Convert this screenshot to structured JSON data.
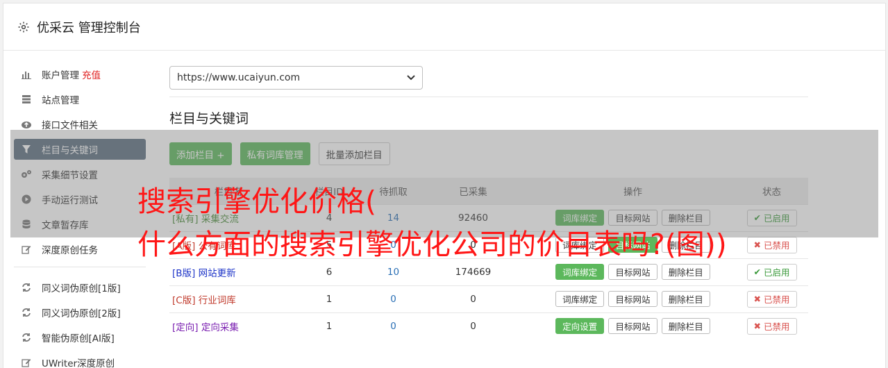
{
  "header": {
    "title": "优采云 管理控制台",
    "icon": "gear-icon"
  },
  "sidebar": {
    "items": [
      {
        "label": "账户管理",
        "badge": "充值",
        "icon": "bar-chart-icon"
      },
      {
        "label": "站点管理",
        "icon": "server-icon"
      },
      {
        "label": "接口文件相关",
        "icon": "cloud-upload-icon"
      },
      {
        "label": "栏目与关键词",
        "icon": "filter-icon",
        "active": true
      },
      {
        "label": "采集细节设置",
        "icon": "cogs-icon"
      },
      {
        "label": "手动运行测试",
        "icon": "play-circle-icon"
      },
      {
        "label": "文章暂存库",
        "icon": "database-icon"
      },
      {
        "label": "深度原创任务",
        "icon": "edit-icon"
      }
    ],
    "items2": [
      {
        "label": "同义词伪原创[1版]",
        "icon": "refresh-icon"
      },
      {
        "label": "同义词伪原创[2版]",
        "icon": "refresh-icon"
      },
      {
        "label": "智能伪原创[AI版]",
        "icon": "refresh-icon"
      },
      {
        "label": "UWriter深度原创",
        "icon": "edit-icon"
      }
    ]
  },
  "main": {
    "site_select": "https://www.ucaiyun.com",
    "section_title": "栏目与关键词",
    "buttons": {
      "add": "添加栏目 +",
      "private": "私有词库管理",
      "batch": "批量添加栏目"
    },
    "table": {
      "headers": [
        "栏目名",
        "栏目ID",
        "待抓取",
        "已采集",
        "操作",
        "状态"
      ],
      "rows": [
        {
          "tag": "[私有]",
          "name": "采集交流",
          "id": "4",
          "pending": "14",
          "collected": "92460",
          "op1": "词库绑定",
          "op2": "目标网站",
          "op3": "删除栏目",
          "status": "已启用"
        },
        {
          "tag": "[A版]",
          "name": "公有词库",
          "id": "5",
          "pending": "0",
          "collected": "0",
          "op1": "词库绑定",
          "op2": "目标网站",
          "op3": "删除栏目",
          "status": "已禁用"
        },
        {
          "tag": "[B版]",
          "name": "网站更新",
          "id": "6",
          "pending": "10",
          "collected": "174669",
          "op1": "词库绑定",
          "op2": "目标网站",
          "op3": "删除栏目",
          "status": "已启用"
        },
        {
          "tag": "[C版]",
          "name": "行业词库",
          "id": "1",
          "pending": "0",
          "collected": "0",
          "op1": "词库绑定",
          "op2": "目标网站",
          "op3": "删除栏目",
          "status": "已禁用"
        },
        {
          "tag": "[定向]",
          "name": "定向采集",
          "id": "1",
          "pending": "0",
          "collected": "0",
          "op1": "定向设置",
          "op2": "目标网站",
          "op3": "删除栏目",
          "status": "已禁用"
        }
      ]
    }
  },
  "watermark": {
    "line1": "搜索引擎优化价格(",
    "line2": "什么方面的搜索引擎优化公司的价目表吗?(图))",
    "color": "#ff1616"
  }
}
